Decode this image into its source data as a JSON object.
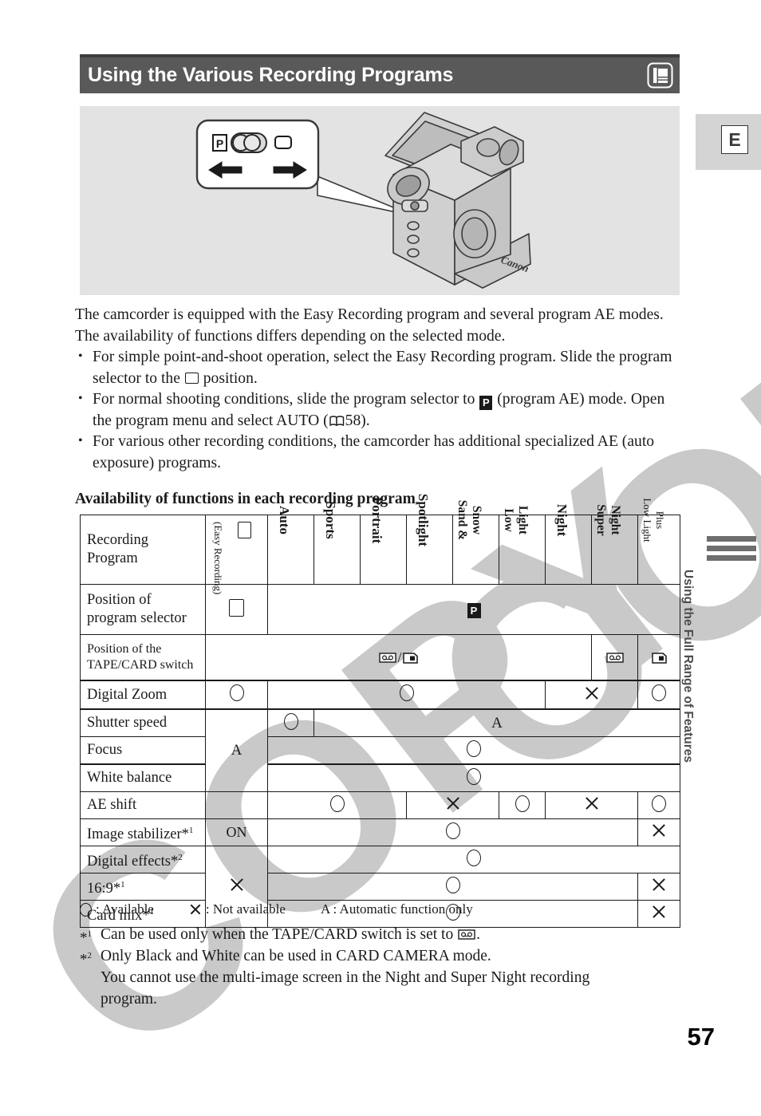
{
  "title_bar": {
    "title": "Using the Various Recording Programs",
    "icon": "camcorder-lcd-icon"
  },
  "edge_tab": {
    "label": "E"
  },
  "running_head": {
    "text": "Using the Full Range of Features"
  },
  "illustration": {
    "callout_icons": {
      "program_p": "P",
      "selector_knob": "selector-knob-icon",
      "easy_rect": "easy-recording-rect-icon",
      "arrow_left": "arrow-left-icon",
      "arrow_right": "arrow-right-icon"
    },
    "device": "canon-camcorder-illustration"
  },
  "body": {
    "intro": "The camcorder is equipped with the Easy Recording program and several program AE modes. The availability of functions differs depending on the selected mode.",
    "bullets": [
      {
        "part1": "For simple point-and-shoot operation, select the Easy Recording program. Slide the program selector to the",
        "icon": "easy-recording-rect-icon",
        "part2": "position."
      },
      {
        "part1": "For normal shooting conditions, slide the program selector to",
        "icon": "program-p-icon",
        "part2": "(program AE) mode. Open the program menu and select AUTO (",
        "book_icon": "book-reference-icon",
        "page_ref": "58",
        "part3": ")."
      },
      {
        "part1": "For various other recording conditions, the camcorder has additional specialized AE (auto exposure) programs.",
        "icon": "",
        "part2": ""
      }
    ]
  },
  "section_heading": "Availability of functions in each recording program",
  "table": {
    "corner_label_line1": "Recording",
    "corner_label_line2": "Program",
    "columns": [
      {
        "label": "(Easy Recording)",
        "icon": "easy-recording-rect-icon",
        "style": "easy"
      },
      {
        "label": "Auto",
        "style": "one"
      },
      {
        "label": "Sports",
        "style": "one"
      },
      {
        "label": "Portrait",
        "style": "one"
      },
      {
        "label": "Spotlight",
        "style": "one"
      },
      {
        "label": "Sand & Snow",
        "line1": "Sand &",
        "line2": "Snow",
        "style": "two"
      },
      {
        "label": "Low Light",
        "line1": "Low",
        "line2": "Light",
        "style": "two"
      },
      {
        "label": "Night",
        "style": "one"
      },
      {
        "label": "Super Night",
        "line1": "Super",
        "line2": "Night",
        "style": "two"
      },
      {
        "label": "Low Light Plus",
        "line1": "Low Light",
        "line2": "Plus",
        "style": "two-small"
      }
    ],
    "rows": [
      {
        "label_line1": "Position of",
        "label_line2": "program selector",
        "small": false,
        "cells": [
          {
            "span": 1,
            "mark": "rect"
          },
          {
            "span": 9,
            "mark": "p"
          }
        ]
      },
      {
        "label_line1": "Position of the",
        "label_line2": "TAPE/CARD switch",
        "small": true,
        "cells": [
          {
            "span": 8,
            "mark": "tape-slash-card"
          },
          {
            "span": 1,
            "mark": "tape"
          },
          {
            "span": 1,
            "mark": "card"
          }
        ]
      },
      {
        "label_line1": "Digital Zoom",
        "label_line2": "",
        "small": false,
        "cells": [
          {
            "span": 1,
            "mark": "circle"
          },
          {
            "span": 6,
            "mark": "circle"
          },
          {
            "span": 2,
            "mark": "cross"
          },
          {
            "span": 1,
            "mark": "circle"
          }
        ]
      },
      {
        "label_line1": "Shutter speed",
        "label_line2": "",
        "small": false,
        "cells": [
          {
            "span": 1,
            "mark": "circle"
          },
          {
            "span": 8,
            "mark": "A"
          }
        ]
      },
      {
        "label_line1": "Focus",
        "label_line2": "",
        "small": false,
        "cells": [
          {
            "span": 9,
            "mark": "circle"
          }
        ]
      },
      {
        "label_line1": "White balance",
        "label_line2": "",
        "small": false,
        "cells": [
          {
            "span": 9,
            "mark": "circle"
          }
        ]
      },
      {
        "label_line1": "AE shift",
        "label_line2": "",
        "small": false,
        "cells": [
          {
            "span": 3,
            "mark": "circle"
          },
          {
            "span": 2,
            "mark": "cross"
          },
          {
            "span": 1,
            "mark": "circle"
          },
          {
            "span": 2,
            "mark": "cross"
          },
          {
            "span": 1,
            "mark": "circle"
          }
        ]
      },
      {
        "label_line1": "Image stabilizer*1",
        "label_line2": "",
        "small": false,
        "cells": [
          {
            "span": 1,
            "mark": "ON"
          },
          {
            "span": 8,
            "mark": "circle"
          },
          {
            "span": 1,
            "mark": "cross"
          }
        ]
      },
      {
        "label_line1": "Digital effects*2",
        "label_line2": "",
        "small": false,
        "cells": [
          {
            "span": 9,
            "mark": "circle"
          }
        ]
      },
      {
        "label_line1": "16:9*1",
        "label_line2": "",
        "small": false,
        "cells": [
          {
            "span": 8,
            "mark": "circle"
          },
          {
            "span": 1,
            "mark": "cross"
          }
        ]
      },
      {
        "label_line1": "Card mix*1",
        "label_line2": "",
        "small": false,
        "cells": [
          {
            "span": 8,
            "mark": "circle"
          },
          {
            "span": 1,
            "mark": "cross"
          }
        ]
      }
    ],
    "merged_labels": {
      "easy_A": "A",
      "easy_X": "✕"
    }
  },
  "legend": {
    "available": ": Available",
    "not_available": ": Not available",
    "automatic": "A : Automatic function only"
  },
  "footnotes": {
    "fn1_mark": "*1",
    "fn1_text_a": "Can be used only when the TAPE/CARD switch is set to",
    "fn1_text_b": ".",
    "fn2_mark": "*2",
    "fn2_line1": "Only Black and White can be used in CARD CAMERA mode.",
    "fn2_line2": "You cannot use the multi-image screen in the Night and Super Night recording",
    "fn2_line3": "program."
  },
  "page_number": "57",
  "watermark": {
    "text": "COPY"
  },
  "colors": {
    "title_bar_bg": "#595959",
    "illustration_bg": "#e3e3e3",
    "edge_tab_bg": "#d4d4d4",
    "running_head": "#4d4d4d",
    "watermark": "#c9c9c9"
  }
}
